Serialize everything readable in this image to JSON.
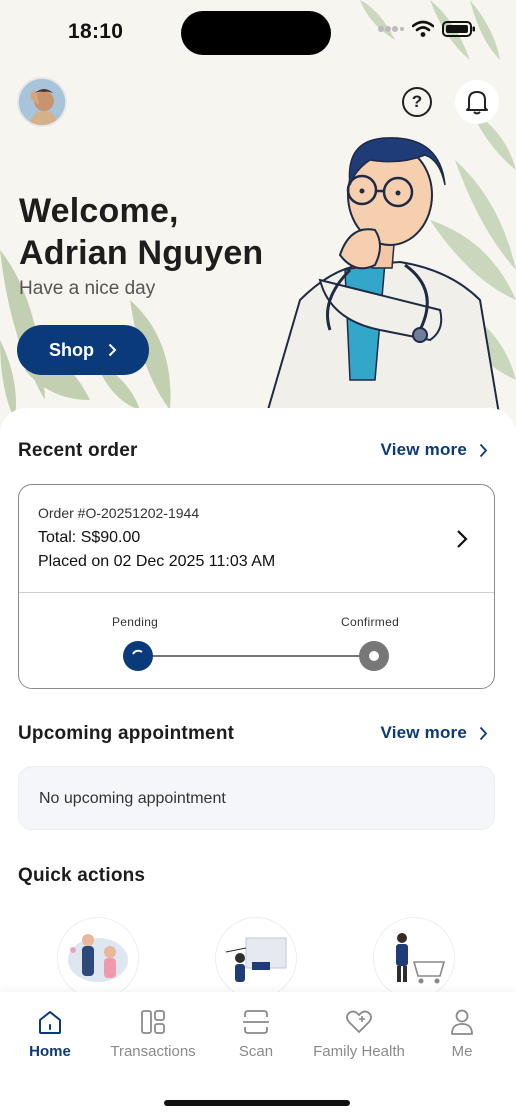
{
  "status": {
    "time": "18:10"
  },
  "header": {
    "help_icon": "?",
    "welcome_line1": "Welcome,",
    "welcome_line2": "Adrian Nguyen",
    "subtitle": "Have a nice day",
    "shop_label": "Shop"
  },
  "recent_order": {
    "title": "Recent order",
    "view_more": "View more",
    "order_no": "Order #O-20251202-1944",
    "total": "Total: S$90.00",
    "placed": "Placed on 02 Dec 2025 11:03 AM",
    "steps": [
      "Pending",
      "Confirmed"
    ]
  },
  "appointment": {
    "title": "Upcoming appointment",
    "view_more": "View more",
    "empty": "No upcoming appointment"
  },
  "quick_actions": {
    "title": "Quick actions"
  },
  "tabs": [
    {
      "label": "Home",
      "icon": "home-icon",
      "active": true
    },
    {
      "label": "Transactions",
      "icon": "transactions-icon"
    },
    {
      "label": "Scan",
      "icon": "scan-icon"
    },
    {
      "label": "Family Health",
      "icon": "heart-plus-icon"
    },
    {
      "label": "Me",
      "icon": "person-icon"
    }
  ],
  "colors": {
    "primary": "#0b3a7a",
    "tab_inactive": "#8a8a8a"
  }
}
